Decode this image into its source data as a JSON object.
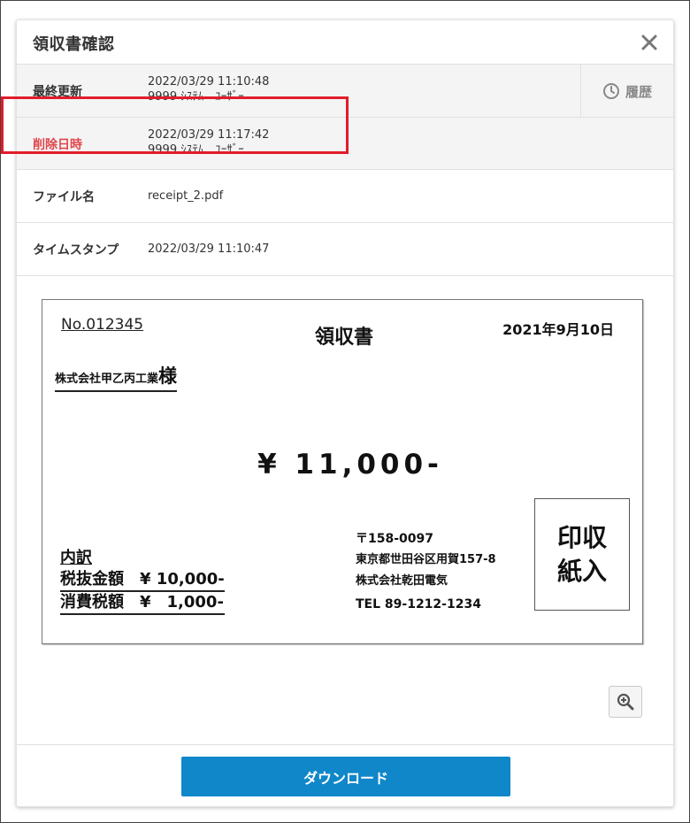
{
  "modal": {
    "title": "領収書確認"
  },
  "details": {
    "updated": {
      "label": "最終更新",
      "datetime": "2022/03/29 11:10:48",
      "user": "9999 ｼｽﾃﾑ　ﾕｰｻﾞｰ"
    },
    "history_button": "履歴",
    "deleted": {
      "label": "削除日時",
      "datetime": "2022/03/29 11:17:42",
      "user": "9999 ｼｽﾃﾑ　ﾕｰｻﾞｰ"
    },
    "file": {
      "label": "ファイル名",
      "value": "receipt_2.pdf"
    },
    "timestamp": {
      "label": "タイムスタンプ",
      "value": "2022/03/29 11:10:47"
    }
  },
  "receipt": {
    "number": "No.012345",
    "title": "領収書",
    "date": "2021年9月10日",
    "company": "株式会社甲乙丙工業",
    "honorific": "様",
    "amount": "¥ 11,000-",
    "breakdown_title": "内訳",
    "tax_excluded": "税抜金額　¥ 10,000-",
    "consumption_tax": "消費税額　¥　1,000-",
    "postal": "〒158-0097",
    "address": "東京都世田谷区用賀157-8",
    "issuer": "株式会社乾田電気",
    "tel": "TEL 89-1212-1234",
    "stamp_line1": "印収",
    "stamp_line2": "紙入"
  },
  "footer": {
    "download_label": "ダウンロード"
  },
  "colors": {
    "deleted_label": "#e0474c",
    "highlight": "#e21c2a",
    "download_button": "#0f87c9"
  },
  "icons": {
    "close": "close-icon",
    "history": "clock-icon",
    "zoom": "zoom-in-icon"
  }
}
